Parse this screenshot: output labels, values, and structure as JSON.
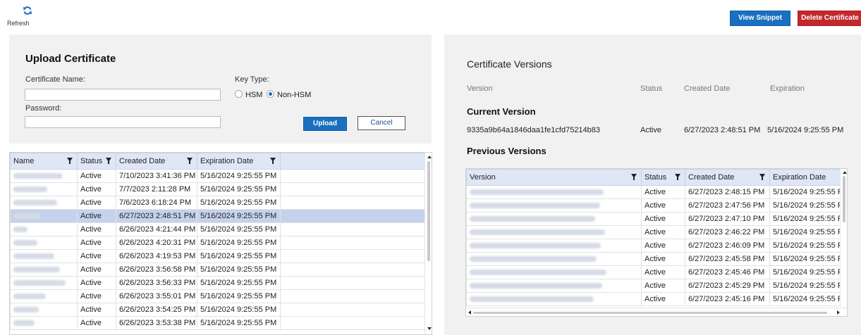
{
  "toolbar": {
    "refresh_label": "Refresh",
    "view_snippet_label": "View Snippet",
    "delete_certificate_label": "Delete Certificate"
  },
  "upload": {
    "title": "Upload Certificate",
    "certificate_name_label": "Certificate Name:",
    "certificate_name_value": "",
    "password_label": "Password:",
    "password_value": "",
    "key_type_label": "Key Type:",
    "key_type_options": [
      "HSM",
      "Non-HSM"
    ],
    "key_type_selected": "Non-HSM",
    "upload_label": "Upload",
    "cancel_label": "Cancel"
  },
  "cert_table": {
    "columns": [
      "Name",
      "Status",
      "Created Date",
      "Expiration Date"
    ],
    "selected_index": 3,
    "rows": [
      {
        "status": "Active",
        "created": "7/10/2023 3:41:36 PM",
        "expiration": "5/16/2024 9:25:55 PM"
      },
      {
        "status": "Active",
        "created": "7/7/2023 2:11:28 PM",
        "expiration": "5/16/2024 9:25:55 PM"
      },
      {
        "status": "Active",
        "created": "7/6/2023 6:18:24 PM",
        "expiration": "5/16/2024 9:25:55 PM"
      },
      {
        "status": "Active",
        "created": "6/27/2023 2:48:51 PM",
        "expiration": "5/16/2024 9:25:55 PM"
      },
      {
        "status": "Active",
        "created": "6/26/2023 4:21:44 PM",
        "expiration": "5/16/2024 9:25:55 PM"
      },
      {
        "status": "Active",
        "created": "6/26/2023 4:20:31 PM",
        "expiration": "5/16/2024 9:25:55 PM"
      },
      {
        "status": "Active",
        "created": "6/26/2023 4:19:53 PM",
        "expiration": "5/16/2024 9:25:55 PM"
      },
      {
        "status": "Active",
        "created": "6/26/2023 3:56:58 PM",
        "expiration": "5/16/2024 9:25:55 PM"
      },
      {
        "status": "Active",
        "created": "6/26/2023 3:56:33 PM",
        "expiration": "5/16/2024 9:25:55 PM"
      },
      {
        "status": "Active",
        "created": "6/26/2023 3:55:01 PM",
        "expiration": "5/16/2024 9:25:55 PM"
      },
      {
        "status": "Active",
        "created": "6/26/2023 3:54:25 PM",
        "expiration": "5/16/2024 9:25:55 PM"
      },
      {
        "status": "Active",
        "created": "6/26/2023 3:53:38 PM",
        "expiration": "5/16/2024 9:25:55 PM"
      }
    ]
  },
  "versions": {
    "title": "Certificate Versions",
    "headers": [
      "Version",
      "Status",
      "Created Date",
      "Expiration"
    ],
    "current_title": "Current Version",
    "current": {
      "version": "9335a9b64a1846daa1fe1cfd75214b83",
      "status": "Active",
      "created": "6/27/2023 2:48:51 PM",
      "expiration": "5/16/2024 9:25:55 PM"
    },
    "previous_title": "Previous Versions",
    "table_columns": [
      "Version",
      "Status",
      "Created Date",
      "Expiration Date"
    ],
    "rows": [
      {
        "status": "Active",
        "created": "6/27/2023 2:48:15 PM",
        "expiration": "5/16/2024 9:25:55 P"
      },
      {
        "status": "Active",
        "created": "6/27/2023 2:47:56 PM",
        "expiration": "5/16/2024 9:25:55 P"
      },
      {
        "status": "Active",
        "created": "6/27/2023 2:47:10 PM",
        "expiration": "5/16/2024 9:25:55 P"
      },
      {
        "status": "Active",
        "created": "6/27/2023 2:46:22 PM",
        "expiration": "5/16/2024 9:25:55 P"
      },
      {
        "status": "Active",
        "created": "6/27/2023 2:46:09 PM",
        "expiration": "5/16/2024 9:25:55 P"
      },
      {
        "status": "Active",
        "created": "6/27/2023 2:45:58 PM",
        "expiration": "5/16/2024 9:25:55 P"
      },
      {
        "status": "Active",
        "created": "6/27/2023 2:45:46 PM",
        "expiration": "5/16/2024 9:25:55 P"
      },
      {
        "status": "Active",
        "created": "6/27/2023 2:45:29 PM",
        "expiration": "5/16/2024 9:25:55 P"
      },
      {
        "status": "Active",
        "created": "6/27/2023 2:45:16 PM",
        "expiration": "5/16/2024 9:25:55 P"
      }
    ]
  },
  "colors": {
    "primary_button": "#1a6fc0",
    "danger_button": "#c2282c",
    "grid_header": "#dfe6f6",
    "selected_row": "#c5d2ec",
    "panel_bg": "#f1f1f1"
  },
  "icons": {
    "refresh": "refresh-icon",
    "filter": "filter-icon"
  }
}
